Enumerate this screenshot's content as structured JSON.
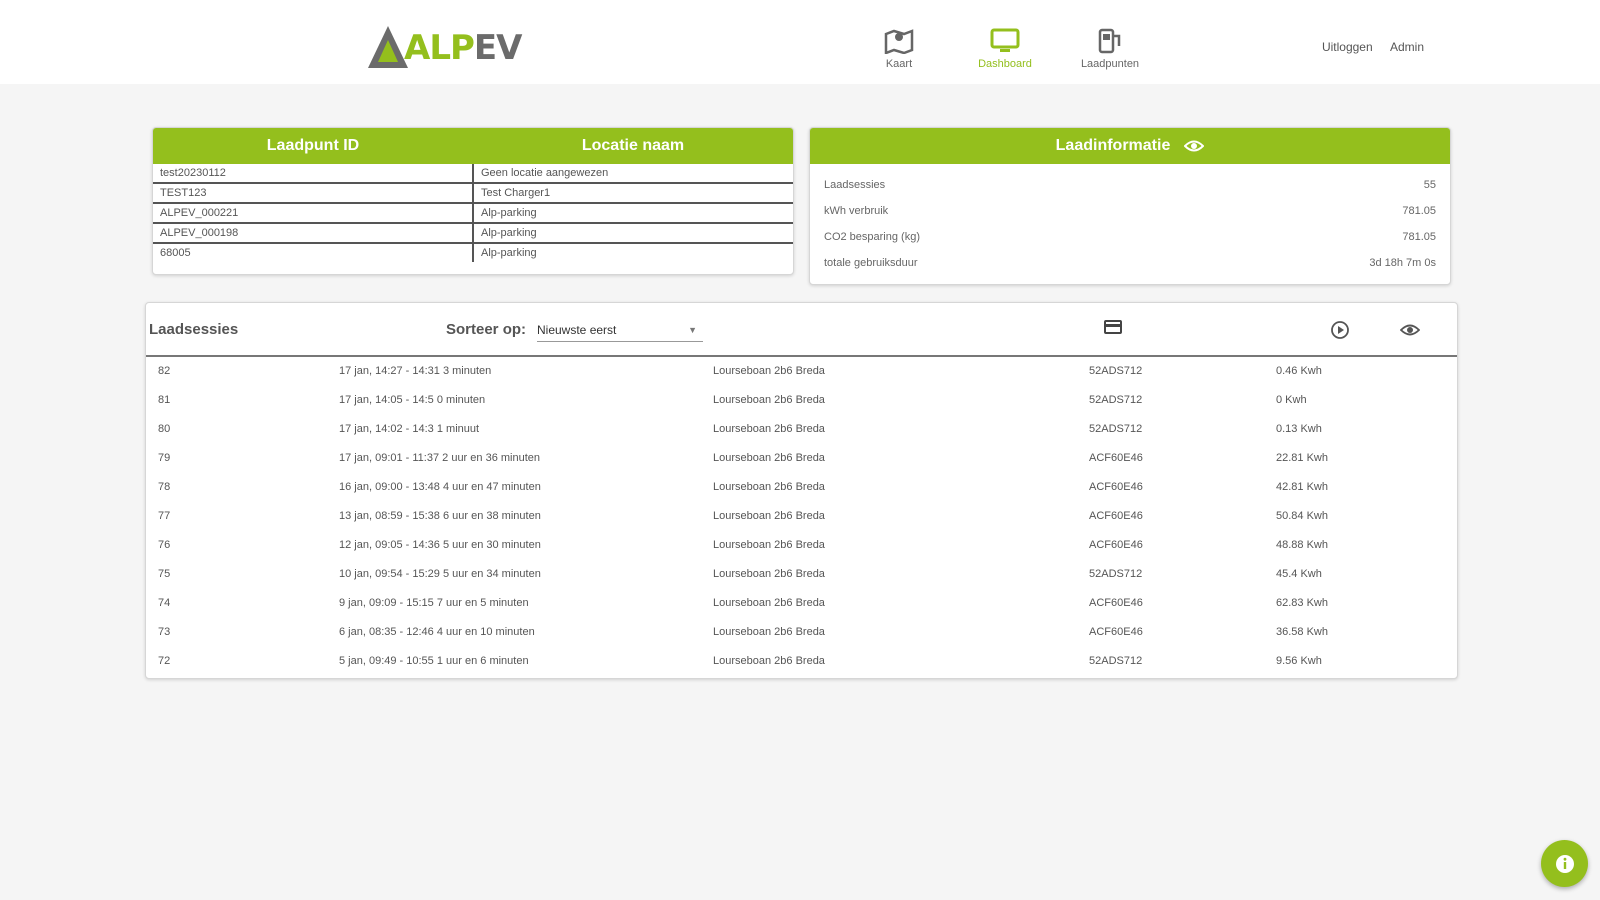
{
  "brand": {
    "logo_text_green": "ALP",
    "logo_text_dark": "EV",
    "accent": "#94bf1d"
  },
  "nav": {
    "items": [
      {
        "label": "Kaart",
        "icon": "map-icon",
        "active": false
      },
      {
        "label": "Dashboard",
        "icon": "monitor-icon",
        "active": true
      },
      {
        "label": "Laadpunten",
        "icon": "charging-station-icon",
        "active": false
      }
    ]
  },
  "user": {
    "logout": "Uitloggen",
    "name": "Admin"
  },
  "points": {
    "headers": [
      "Laadpunt ID",
      "Locatie naam"
    ],
    "rows": [
      [
        "test20230112",
        "Geen locatie aangewezen"
      ],
      [
        "TEST123",
        "Test Charger1"
      ],
      [
        "ALPEV_000221",
        "Alp-parking"
      ],
      [
        "ALPEV_000198",
        "Alp-parking"
      ],
      [
        "68005",
        "Alp-parking"
      ]
    ]
  },
  "info": {
    "title": "Laadinformatie",
    "icon": "eye-icon",
    "rows": [
      {
        "label": "Laadsessies",
        "value": "55"
      },
      {
        "label": "kWh verbruik",
        "value": "781.05"
      },
      {
        "label": "CO2 besparing (kg)",
        "value": "781.05"
      },
      {
        "label": "totale gebruiksduur",
        "value": "3d 18h 7m 0s"
      }
    ]
  },
  "sessions": {
    "title": "Laadsessies",
    "sort_label": "Sorteer op:",
    "sort_value": "Nieuwste eerst",
    "icons": [
      "card-icon",
      "play-icon",
      "eye-icon"
    ],
    "rows": [
      [
        "82",
        "17 jan, 14:27 - 14:31 3 minuten",
        "Lourseboan 2b6 Breda",
        "52ADS712",
        "0.46 Kwh"
      ],
      [
        "81",
        "17 jan, 14:05 - 14:5 0 minuten",
        "Lourseboan 2b6 Breda",
        "52ADS712",
        "0 Kwh"
      ],
      [
        "80",
        "17 jan, 14:02 - 14:3 1 minuut",
        "Lourseboan 2b6 Breda",
        "52ADS712",
        "0.13 Kwh"
      ],
      [
        "79",
        "17 jan, 09:01 - 11:37 2 uur en 36 minuten",
        "Lourseboan 2b6 Breda",
        "ACF60E46",
        "22.81 Kwh"
      ],
      [
        "78",
        "16 jan, 09:00 - 13:48 4 uur en 47 minuten",
        "Lourseboan 2b6 Breda",
        "ACF60E46",
        "42.81 Kwh"
      ],
      [
        "77",
        "13 jan, 08:59 - 15:38 6 uur en 38 minuten",
        "Lourseboan 2b6 Breda",
        "ACF60E46",
        "50.84 Kwh"
      ],
      [
        "76",
        "12 jan, 09:05 - 14:36 5 uur en 30 minuten",
        "Lourseboan 2b6 Breda",
        "ACF60E46",
        "48.88 Kwh"
      ],
      [
        "75",
        "10 jan, 09:54 - 15:29 5 uur en 34 minuten",
        "Lourseboan 2b6 Breda",
        "52ADS712",
        "45.4 Kwh"
      ],
      [
        "74",
        "9 jan, 09:09 - 15:15 7 uur en 5 minuten",
        "Lourseboan 2b6 Breda",
        "ACF60E46",
        "62.83 Kwh"
      ],
      [
        "73",
        "6 jan, 08:35 - 12:46 4 uur en 10 minuten",
        "Lourseboan 2b6 Breda",
        "ACF60E46",
        "36.58 Kwh"
      ],
      [
        "72",
        "5 jan, 09:49 - 10:55 1 uur en 6 minuten",
        "Lourseboan 2b6 Breda",
        "52ADS712",
        "9.56 Kwh"
      ]
    ]
  },
  "fab": {
    "icon": "info-icon"
  }
}
